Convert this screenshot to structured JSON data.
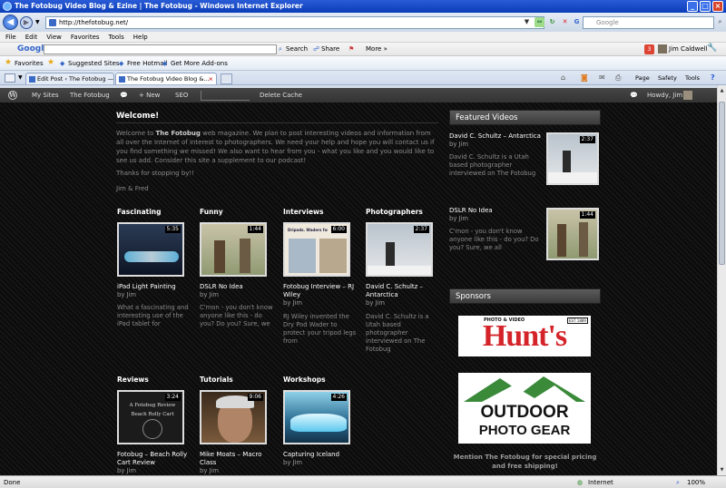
{
  "window": {
    "title": "The Fotobug Video Blog & Ezine | The Fotobug - Windows Internet Explorer"
  },
  "address": {
    "url": "http://thefotobug.net/",
    "search_placeholder": "Google"
  },
  "menu": [
    "File",
    "Edit",
    "View",
    "Favorites",
    "Tools",
    "Help"
  ],
  "google_toolbar": {
    "logo": "Google",
    "search_label": "Search",
    "share_label": "Share",
    "more_label": "More »",
    "badge": "3",
    "user": "Jim Caldwell"
  },
  "favorites_bar": {
    "favorites": "Favorites",
    "suggested": "Suggested Sites",
    "hotmail": "Free Hotmail",
    "addons": "Get More Add-ons"
  },
  "tabs": [
    {
      "label": "Edit Post ‹ The Fotobug — W..."
    },
    {
      "label": "The Fotobug Video Blog &..."
    }
  ],
  "command_bar": {
    "page": "Page",
    "safety": "Safety",
    "tools": "Tools"
  },
  "wp_bar": {
    "my_sites": "My Sites",
    "site": "The Fotobug",
    "new": "+ New",
    "seo": "SEO",
    "delete_cache": "Delete Cache",
    "howdy": "Howdy, Jim"
  },
  "welcome": {
    "title": "Welcome!",
    "para1_prefix": "Welcome to ",
    "para1_brand": "The Fotobug",
    "para1_rest": " web magazine. We plan to post interesting videos and information from all over the Internet of interest to photographers. We need your help and hope you will contact us if you find something we missed! We also want to hear from you - what you like and you would like to see us add. Consider this site a supplement to our podcast!",
    "para2": "Thanks for stopping by!!",
    "para3": "Jim & Fred"
  },
  "categories": [
    {
      "name": "Fascinating",
      "duration": "5:35",
      "title": "iPad Light Painting",
      "by": "by Jim",
      "desc": "What a fascinating and interesting use of the iPad tablet for"
    },
    {
      "name": "Funny",
      "duration": "1:44",
      "title": "DSLR No Idea",
      "by": "by Jim",
      "desc": "C'mon - you don't know anyone like this - do you? Do you? Sure, we"
    },
    {
      "name": "Interviews",
      "duration": "6:00",
      "title": "Fotobug Interview – RJ Wiley",
      "by": "by Jim",
      "desc": "RJ Wiley invented the Dry Pod Wader to protect your tripod legs from"
    },
    {
      "name": "Photographers",
      "duration": "2:37",
      "title": "David C. Schultz – Antarctica",
      "by": "by Jim",
      "desc": "David C. Schultz is a Utah based photographer interviewed on The Fotobug"
    },
    {
      "name": "Reviews",
      "duration": "3:24",
      "title": "Fotobug – Beach Rolly Cart Review",
      "by": "by Jim",
      "desc": ""
    },
    {
      "name": "Tutorials",
      "duration": "9:06",
      "title": "Mike Moats – Macro Class",
      "by": "by Jim",
      "desc": ""
    },
    {
      "name": "Workshops",
      "duration": "4:26",
      "title": "Capturing Iceland",
      "by": "by Jim",
      "desc": ""
    }
  ],
  "thumb_texts": {
    "interview_headline": "Dripods. Waders for your...",
    "review_line1": "A Fotobug Review",
    "review_line2": "Beach Rolly Cart"
  },
  "sidebar": {
    "featured_title": "Featured Videos",
    "featured": [
      {
        "title": "David C. Schultz – Antarctica",
        "by": "by Jim",
        "desc": "David C. Schultz is a Utah based photographer interviewed on The Fotobug",
        "duration": "2:37"
      },
      {
        "title": "DSLR No Idea",
        "by": "by Jim",
        "desc": "C'mon - you don't know anyone like this - do you? Do you? Sure, we all",
        "duration": "1:44"
      }
    ],
    "sponsors_title": "Sponsors",
    "hunts_top": "PHOTO & VIDEO",
    "hunts_name": "Hunt's",
    "hunts_est": "EST 1889",
    "outdoor_line1": "OUTDOOR",
    "outdoor_line2": "PHOTO GEAR",
    "mention": "Mention The Fotobug for special pricing and free shipping!"
  },
  "status": {
    "left": "Done",
    "zone": "Internet",
    "zoom": "100%"
  }
}
